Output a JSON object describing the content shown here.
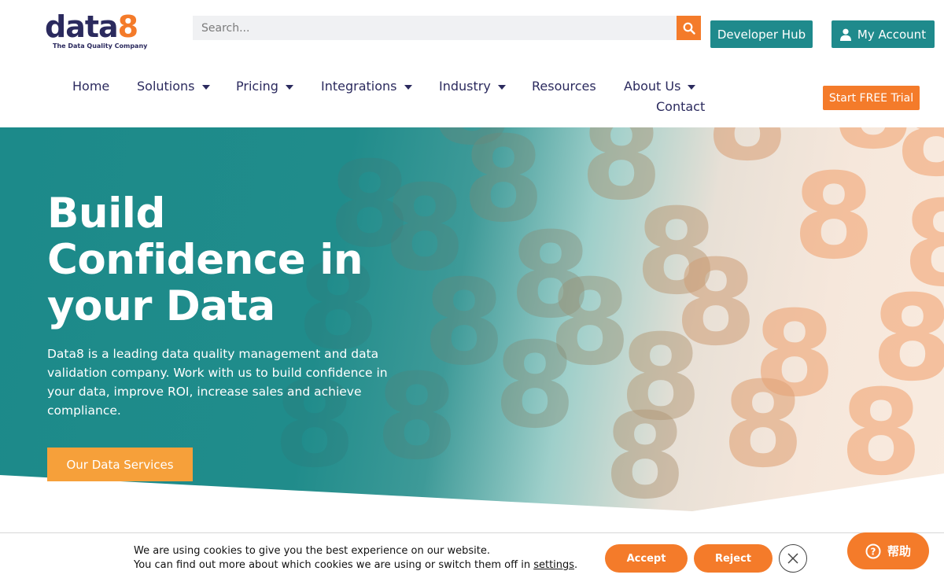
{
  "header": {
    "logo": {
      "brand_main": "data",
      "brand_accent": "8",
      "tagline": "The Data Quality Company"
    },
    "search": {
      "placeholder": "Search...",
      "icon": "search-icon"
    },
    "developer_hub_label": "Developer Hub",
    "my_account_label": "My Account",
    "account_icon": "user-icon",
    "trial_label": "Start FREE Trial"
  },
  "nav": {
    "items": [
      {
        "label": "Home"
      },
      {
        "label": "Solutions",
        "has_dropdown": true
      },
      {
        "label": "Pricing",
        "has_dropdown": true
      },
      {
        "label": "Integrations",
        "has_dropdown": true
      },
      {
        "label": "Industry",
        "has_dropdown": true
      },
      {
        "label": "Resources"
      },
      {
        "label": "About Us",
        "has_dropdown": true
      },
      {
        "label": "Contact"
      }
    ]
  },
  "hero": {
    "title_line1": "Build",
    "title_line2": "Confidence in",
    "title_line3": "your Data",
    "subtitle": "Data8 is a leading data quality management and data validation company. Work with us to build confidence in your data, improve ROI, increase sales and achieve compliance.",
    "cta_label": "Our Data Services",
    "decor_glyph": "8"
  },
  "cookie": {
    "line1": "We are using cookies to give you the best experience on our website.",
    "line2_prefix": "You can find out more about which cookies we are using or switch them off in",
    "settings_link": "settings",
    "line2_suffix": ".",
    "accept_label": "Accept",
    "reject_label": "Reject",
    "close_icon": "close-icon"
  },
  "help_widget": {
    "label": "帮助",
    "icon": "question-circle-icon"
  },
  "colors": {
    "brand_navy": "#2b2a5e",
    "brand_orange": "#f47b2a",
    "teal": "#1f8a8c",
    "cta_orange": "#f6a03a"
  }
}
